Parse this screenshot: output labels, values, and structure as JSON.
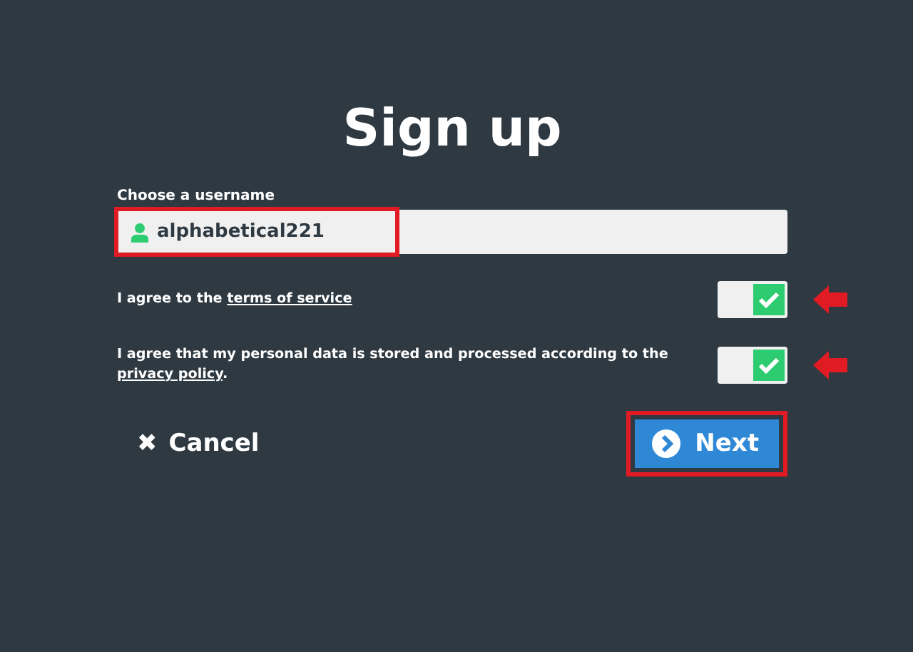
{
  "title": "Sign up",
  "username": {
    "label": "Choose a username",
    "value": "alphabetical221",
    "highlighted": true
  },
  "agreements": [
    {
      "text": "I agree to the ",
      "link": "terms of service",
      "checked": true,
      "arrow": true
    },
    {
      "text": "I agree that my personal data is stored and processed according to the ",
      "link": "privacy policy",
      "after": ".",
      "checked": true,
      "arrow": true
    }
  ],
  "cancel": {
    "icon": "✖",
    "label": "Cancel"
  },
  "next": {
    "label": "Next",
    "highlighted": true
  }
}
